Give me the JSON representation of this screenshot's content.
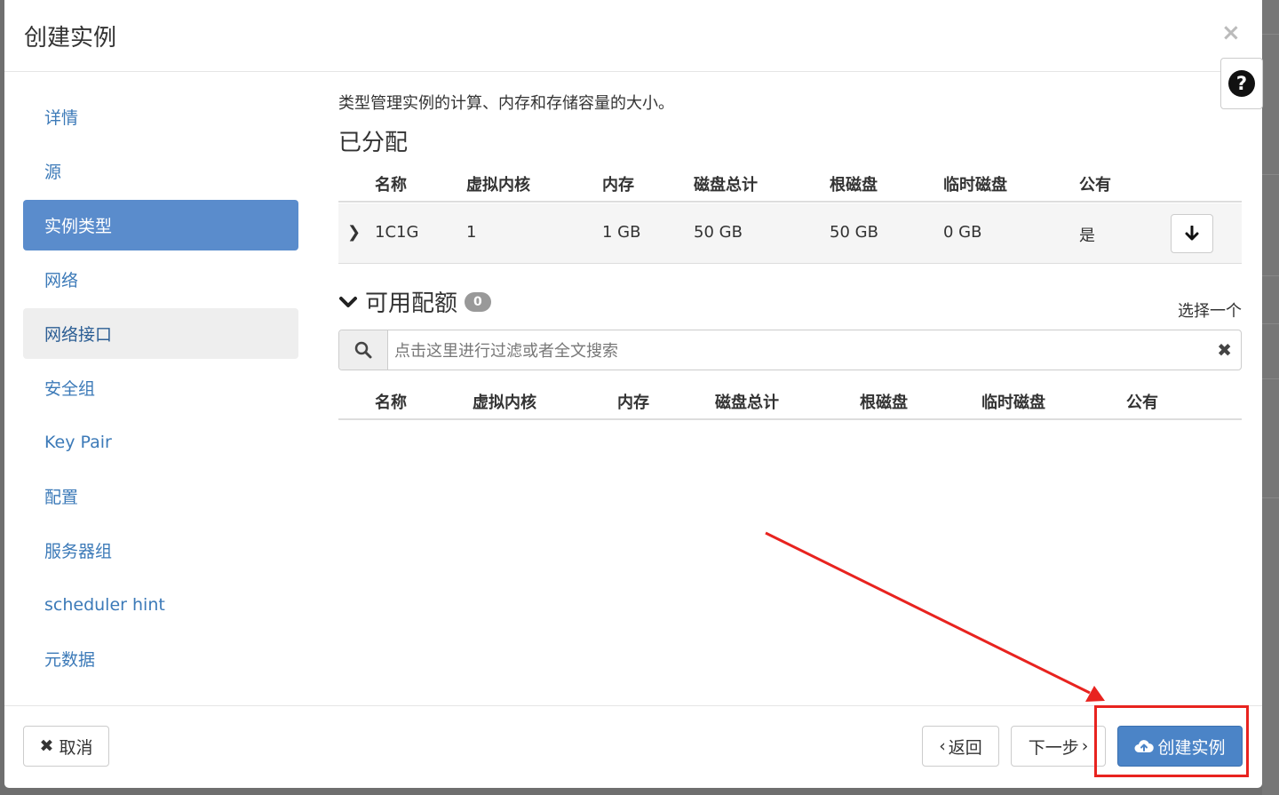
{
  "modal": {
    "title": "创建实例",
    "close_icon": "×",
    "help_icon": "?"
  },
  "sidebar": {
    "items": [
      {
        "label": "详情"
      },
      {
        "label": "源"
      },
      {
        "label": "实例类型",
        "active": true
      },
      {
        "label": "网络"
      },
      {
        "label": "网络接口",
        "highlighted": true
      },
      {
        "label": "安全组"
      },
      {
        "label": "Key Pair"
      },
      {
        "label": "配置"
      },
      {
        "label": "服务器组"
      },
      {
        "label": "scheduler hint"
      },
      {
        "label": "元数据"
      }
    ]
  },
  "main": {
    "help_text": "类型管理实例的计算、内存和存储容量的大小。",
    "allocated": {
      "heading": "已分配",
      "columns": [
        "名称",
        "虚拟内核",
        "内存",
        "磁盘总计",
        "根磁盘",
        "临时磁盘",
        "公有"
      ],
      "rows": [
        {
          "name": "1C1G",
          "vcpus": "1",
          "ram": "1 GB",
          "disk_total": "50 GB",
          "root_disk": "50 GB",
          "ephemeral": "0 GB",
          "public": "是"
        }
      ]
    },
    "available": {
      "heading": "可用配额",
      "count": "0",
      "select_hint": "选择一个",
      "search_placeholder": "点击这里进行过滤或者全文搜索",
      "columns": [
        "名称",
        "虚拟内核",
        "内存",
        "磁盘总计",
        "根磁盘",
        "临时磁盘",
        "公有"
      ]
    }
  },
  "footer": {
    "cancel_label": "取消",
    "back_label": "返回",
    "next_label": "下一步",
    "create_label": "创建实例"
  },
  "colors": {
    "primary": "#4b84c7",
    "active_nav": "#5a8ccc",
    "link": "#3c7ab8",
    "annotation": "#e8231f"
  }
}
